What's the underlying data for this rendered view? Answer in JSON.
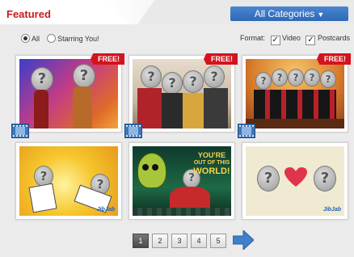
{
  "header": {
    "title": "Featured",
    "categories_label": "All Categories"
  },
  "filters": {
    "all_label": "All",
    "starring_label": "Starring You!",
    "format_label": "Format:",
    "video_label": "Video",
    "postcards_label": "Postcards",
    "selected_radio": "All"
  },
  "cards": [
    {
      "badge": "FREE!",
      "type": "video"
    },
    {
      "badge": "FREE!",
      "type": "video"
    },
    {
      "badge": "FREE!",
      "type": "video"
    },
    {
      "type": "postcard"
    },
    {
      "type": "postcard",
      "poster_line1": "YOU'RE",
      "poster_line2": "OUT OF THIS",
      "poster_line3": "WORLD!"
    },
    {
      "type": "postcard"
    }
  ],
  "pagination": {
    "pages": [
      "1",
      "2",
      "3",
      "4",
      "5"
    ],
    "current": "1"
  },
  "colors": {
    "brand_red": "#c81a1a",
    "accent_blue": "#2e68b6",
    "ribbon_red": "#d3131e"
  },
  "icons": {
    "category_chevron": "chevron-down-icon",
    "next": "arrow-right-icon",
    "film": "film-icon"
  }
}
